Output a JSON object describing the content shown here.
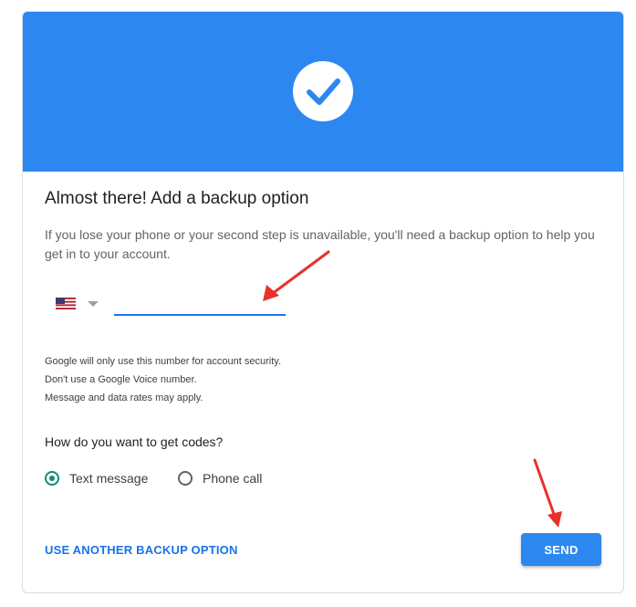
{
  "theme": {
    "banner_color": "#2d87f0",
    "accent_color": "#1a73e8",
    "radio_color": "#138a72",
    "annotation_arrow_color": "#e8312a"
  },
  "banner": {
    "icon": "check-icon"
  },
  "title": "Almost there! Add a backup option",
  "description": "If you lose your phone or your second step is unavailable, you'll need a backup option to help you get in to your account.",
  "phone": {
    "country_icon": "us-flag-icon",
    "value": "",
    "placeholder": ""
  },
  "notes": [
    "Google will only use this number for account security.",
    "Don't use a Google Voice number.",
    "Message and data rates may apply."
  ],
  "codes": {
    "question": "How do you want to get codes?",
    "options": [
      {
        "label": "Text message",
        "selected": true
      },
      {
        "label": "Phone call",
        "selected": false
      }
    ]
  },
  "actions": {
    "alternate_label": "USE ANOTHER BACKUP OPTION",
    "send_label": "SEND"
  }
}
